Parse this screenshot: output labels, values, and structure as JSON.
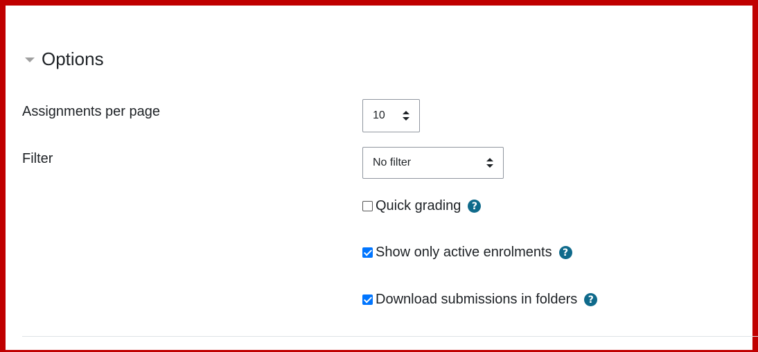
{
  "section": {
    "title": "Options",
    "icon": "caret-down-icon"
  },
  "assignments_per_page": {
    "label": "Assignments per page",
    "selected": "10"
  },
  "filter": {
    "label": "Filter",
    "selected": "No filter"
  },
  "checkboxes": [
    {
      "label": "Quick grading",
      "checked": false
    },
    {
      "label": "Show only active enrolments",
      "checked": true
    },
    {
      "label": "Download submissions in folders",
      "checked": true
    }
  ],
  "colors": {
    "border_accent": "#c00000",
    "help_icon": "#0f6a8b",
    "checkbox_checked": "#0075ff"
  }
}
